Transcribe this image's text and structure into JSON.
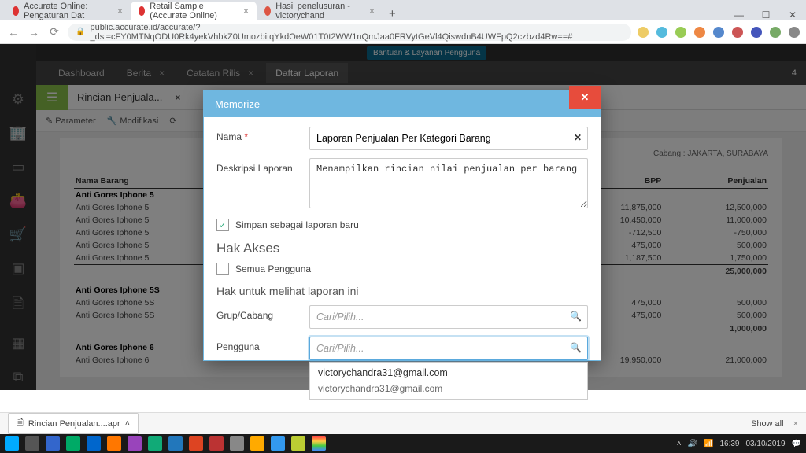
{
  "browser": {
    "tabs": [
      {
        "title": "Accurate Online: Pengaturan Dat",
        "favColor": "#d33"
      },
      {
        "title": "Retail Sample (Accurate Online)",
        "favColor": "#d33",
        "active": true
      },
      {
        "title": "Hasil penelusuran - victorychand",
        "favColor": "#d54"
      }
    ],
    "url": "public.accurate.id/accurate/?_dsi=cFY0MTNqODU0Rk4yekVhbkZ0UmozbitqYkdOeW01T0t2WW1nQmJaa0FRVytGeVl4QiswdnB4UWFpQ2czbzd4Rw==#",
    "winMin": "—",
    "winMax": "☐",
    "winClose": "✕"
  },
  "app": {
    "helpBtn": "Bantuan & Layanan Pengguna",
    "tabs": [
      {
        "label": "Dashboard"
      },
      {
        "label": "Berita"
      },
      {
        "label": "Catatan Rilis"
      },
      {
        "label": "Daftar Laporan",
        "active": true
      }
    ],
    "notifCount": "4",
    "subheader": {
      "title": "Rincian Penjuala..."
    },
    "toolbar": {
      "parameter": "Parameter",
      "modifikasi": "Modifikasi"
    }
  },
  "modal": {
    "title": "Memorize",
    "labels": {
      "nama": "Nama",
      "deskripsi": "Deskripsi Laporan",
      "simpan": "Simpan sebagai laporan baru",
      "hakAkses": "Hak Akses",
      "semua": "Semua Pengguna",
      "hakMelihat": "Hak untuk melihat laporan ini",
      "grup": "Grup/Cabang",
      "pengguna": "Pengguna"
    },
    "values": {
      "nama": "Laporan Penjualan Per Kategori Barang",
      "deskripsi": "Menampilkan rincian nilai penjualan per barang",
      "simpanChecked": "✓"
    },
    "placeholders": {
      "cari": "Cari/Pilih..."
    },
    "dropdown": {
      "line1": "victorychandra31@gmail.com",
      "line2": "victorychandra31@gmail.com"
    }
  },
  "report": {
    "headerRight": "Cabang : JAKARTA, SURABAYA",
    "columns": {
      "nama": "Nama Barang",
      "bpp": "BPP",
      "penjualan": "Penjualan"
    },
    "rows": [
      {
        "bold": true,
        "name": "Anti Gores Iphone 5"
      },
      {
        "name": "Anti Gores Iphone 5",
        "bpp": "11,875,000",
        "penjualan": "12,500,000"
      },
      {
        "name": "Anti Gores Iphone 5",
        "bpp": "10,450,000",
        "penjualan": "11,000,000"
      },
      {
        "name": "Anti Gores Iphone 5",
        "bpp": "-712,500",
        "penjualan": "-750,000"
      },
      {
        "name": "Anti Gores Iphone 5",
        "bpp": "475,000",
        "penjualan": "500,000"
      },
      {
        "name": "Anti Gores Iphone 5",
        "bpp": "1,187,500",
        "penjualan": "1,750,000"
      },
      {
        "total": true,
        "bpp": "",
        "penjualan": "25,000,000"
      },
      {
        "spacer": true
      },
      {
        "bold": true,
        "name": "Anti Gores Iphone 5S"
      },
      {
        "name": "Anti Gores Iphone 5S",
        "bpp": "475,000",
        "penjualan": "500,000"
      },
      {
        "name": "Anti Gores Iphone 5S",
        "bpp": "475,000",
        "penjualan": "500,000"
      },
      {
        "total": true,
        "bpp": "",
        "penjualan": "1,000,000"
      },
      {
        "spacer": true
      },
      {
        "bold": true,
        "name": "Anti Gores Iphone 6"
      },
      {
        "name": "Anti Gores Iphone 6",
        "bpp": "19,950,000",
        "penjualan": "21,000,000"
      }
    ]
  },
  "download": {
    "file": "Rincian Penjualan....apr",
    "showAll": "Show all"
  },
  "clock": {
    "time": "16:39",
    "date": "03/10/2019"
  }
}
